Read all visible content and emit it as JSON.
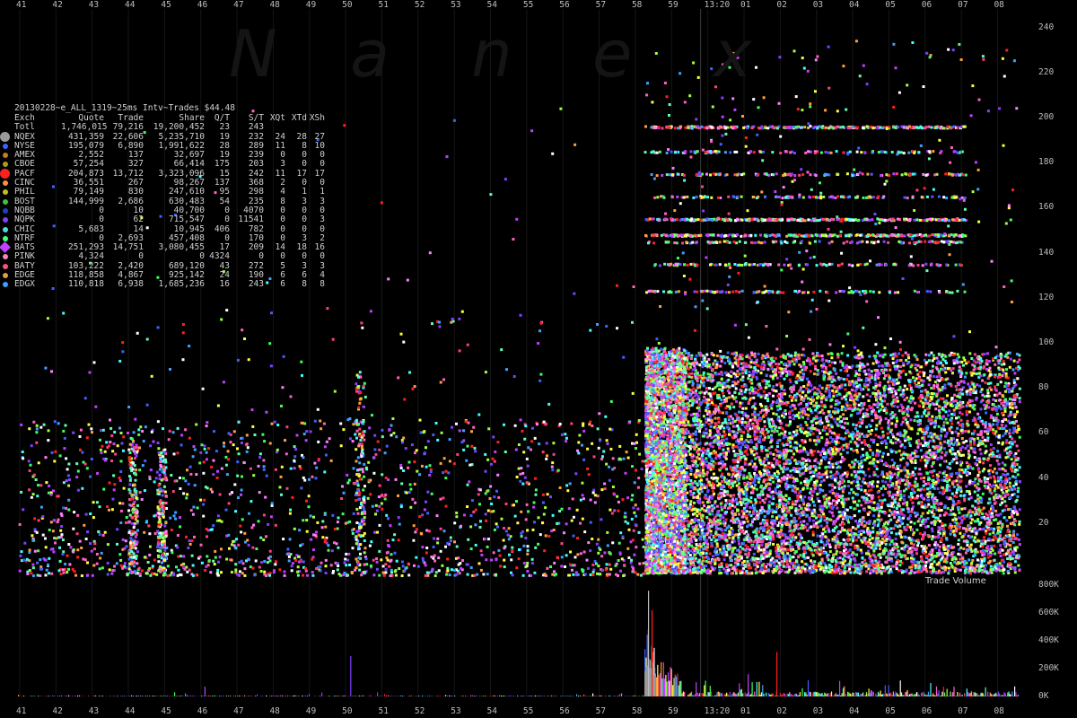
{
  "header": {
    "title": "20130228~e_ALL_1319~25ms Intv~Trades $44.48",
    "watermark": [
      "N",
      "a",
      "n",
      "e",
      "x"
    ]
  },
  "table": {
    "columns": [
      "Exch",
      "Quote",
      "Trade",
      "Share",
      "Q/T",
      "S/T",
      "XQt",
      "XTd",
      "XSh"
    ],
    "rows": [
      {
        "exch": "Totl",
        "quote": "1,746,015",
        "trade": "79,216",
        "share": "19,200,452",
        "qt": "23",
        "st": "243",
        "xqt": "",
        "xtd": "",
        "xsh": "",
        "color": ""
      },
      {
        "exch": "NQEX",
        "quote": "431,359",
        "trade": "22,606",
        "share": "5,235,710",
        "qt": "19",
        "st": "232",
        "xqt": "24",
        "xtd": "28",
        "xsh": "27",
        "color": "#9a9a9a"
      },
      {
        "exch": "NYSE",
        "quote": "195,079",
        "trade": "6,890",
        "share": "1,991,622",
        "qt": "28",
        "st": "289",
        "xqt": "11",
        "xtd": "8",
        "xsh": "10",
        "color": "#4060ff"
      },
      {
        "exch": "AMEX",
        "quote": "2,552",
        "trade": "137",
        "share": "32,697",
        "qt": "19",
        "st": "239",
        "xqt": "0",
        "xtd": "0",
        "xsh": "0",
        "color": "#c08020"
      },
      {
        "exch": "CBOE",
        "quote": "57,254",
        "trade": "327",
        "share": "66,414",
        "qt": "175",
        "st": "203",
        "xqt": "3",
        "xtd": "0",
        "xsh": "0",
        "color": "#a0a020"
      },
      {
        "exch": "PACF",
        "quote": "204,873",
        "trade": "13,712",
        "share": "3,323,096",
        "qt": "15",
        "st": "242",
        "xqt": "11",
        "xtd": "17",
        "xsh": "17",
        "color": "#ff2020"
      },
      {
        "exch": "CINC",
        "quote": "36,551",
        "trade": "267",
        "share": "98,267",
        "qt": "137",
        "st": "368",
        "xqt": "2",
        "xtd": "0",
        "xsh": "0",
        "color": "#ff9040"
      },
      {
        "exch": "PHIL",
        "quote": "79,149",
        "trade": "830",
        "share": "247,610",
        "qt": "95",
        "st": "298",
        "xqt": "4",
        "xtd": "1",
        "xsh": "1",
        "color": "#c0c020"
      },
      {
        "exch": "BOST",
        "quote": "144,999",
        "trade": "2,686",
        "share": "630,483",
        "qt": "54",
        "st": "235",
        "xqt": "8",
        "xtd": "3",
        "xsh": "3",
        "color": "#40c040"
      },
      {
        "exch": "NQBB",
        "quote": "0",
        "trade": "10",
        "share": "40,700",
        "qt": "0",
        "st": "4070",
        "xqt": "0",
        "xtd": "0",
        "xsh": "0",
        "color": "#2040c0"
      },
      {
        "exch": "NQPK",
        "quote": "0",
        "trade": "62",
        "share": "715,547",
        "qt": "0",
        "st": "11541",
        "xqt": "0",
        "xtd": "0",
        "xsh": "3",
        "color": "#8040ff"
      },
      {
        "exch": "CHIC",
        "quote": "5,683",
        "trade": "14",
        "share": "10,945",
        "qt": "406",
        "st": "782",
        "xqt": "0",
        "xtd": "0",
        "xsh": "0",
        "color": "#40e0e0"
      },
      {
        "exch": "NTRF",
        "quote": "0",
        "trade": "2,693",
        "share": "457,408",
        "qt": "0",
        "st": "170",
        "xqt": "0",
        "xtd": "3",
        "xsh": "2",
        "color": "#40ff80"
      },
      {
        "exch": "BATS",
        "quote": "251,293",
        "trade": "14,751",
        "share": "3,080,455",
        "qt": "17",
        "st": "209",
        "xqt": "14",
        "xtd": "18",
        "xsh": "16",
        "color": "#c040ff"
      },
      {
        "exch": "PINK",
        "quote": "4,324",
        "trade": "0",
        "share": "0",
        "qt": "4324",
        "st": "0",
        "xqt": "0",
        "xtd": "0",
        "xsh": "0",
        "color": "#ff80c0"
      },
      {
        "exch": "BATY",
        "quote": "103,222",
        "trade": "2,420",
        "share": "689,120",
        "qt": "43",
        "st": "272",
        "xqt": "5",
        "xtd": "3",
        "xsh": "3",
        "color": "#ff5080"
      },
      {
        "exch": "EDGE",
        "quote": "118,858",
        "trade": "4,867",
        "share": "925,142",
        "qt": "24",
        "st": "190",
        "xqt": "6",
        "xtd": "6",
        "xsh": "4",
        "color": "#e0a040"
      },
      {
        "exch": "EDGX",
        "quote": "110,818",
        "trade": "6,938",
        "share": "1,685,236",
        "qt": "16",
        "st": "243",
        "xqt": "6",
        "xtd": "8",
        "xsh": "8",
        "color": "#40a0ff"
      }
    ]
  },
  "chart_data": {
    "type": "scatter",
    "x_ticks": [
      "41",
      "42",
      "43",
      "44",
      "45",
      "46",
      "47",
      "48",
      "49",
      "50",
      "51",
      "52",
      "53",
      "54",
      "55",
      "56",
      "57",
      "58",
      "59",
      "13:20",
      "01",
      "02",
      "03",
      "04",
      "05",
      "06",
      "07",
      "08"
    ],
    "upper_axis": {
      "label": "",
      "ticks": [
        "20",
        "40",
        "60",
        "80",
        "100",
        "120",
        "140",
        "160",
        "180",
        "200",
        "220",
        "240"
      ],
      "ylim": [
        0,
        245
      ]
    },
    "lower_axis": {
      "label": "Trade Volume",
      "ticks": [
        "0K",
        "200K",
        "400K",
        "600K",
        "800K"
      ],
      "ylim": [
        0,
        800000
      ]
    },
    "palette": [
      "#ff2020",
      "#ff4080",
      "#40ffff",
      "#8040ff",
      "#40ff60",
      "#ffff40",
      "#ff80ff",
      "#40a0ff",
      "#ffa040",
      "#a0ff40",
      "#c040ff",
      "#ff60c0",
      "#60ffb0",
      "#4060ff",
      "#ffffff"
    ],
    "dense_regions": [
      {
        "x_from": "58",
        "x_to": "08",
        "y_from": 5,
        "y_to": 100,
        "density": "very high"
      },
      {
        "x_from": "41",
        "x_to": "58",
        "y_from": 5,
        "y_to": 65,
        "density": "moderate"
      }
    ],
    "price_bands": [
      201,
      190,
      180,
      170,
      160,
      153,
      150,
      140,
      128
    ],
    "volume_spikes": [
      {
        "x": "58.3",
        "value": 760000,
        "series": "NQEX"
      },
      {
        "x": "58.4",
        "value": 620000,
        "series": "PACF"
      },
      {
        "x": "50",
        "value": 290000,
        "series": "NQPK"
      },
      {
        "x": "02",
        "value": 320000,
        "series": "PACF"
      },
      {
        "x": "01",
        "value": 160000,
        "series": "BATS"
      },
      {
        "x": "46",
        "value": 70000,
        "series": "BATS"
      }
    ]
  }
}
